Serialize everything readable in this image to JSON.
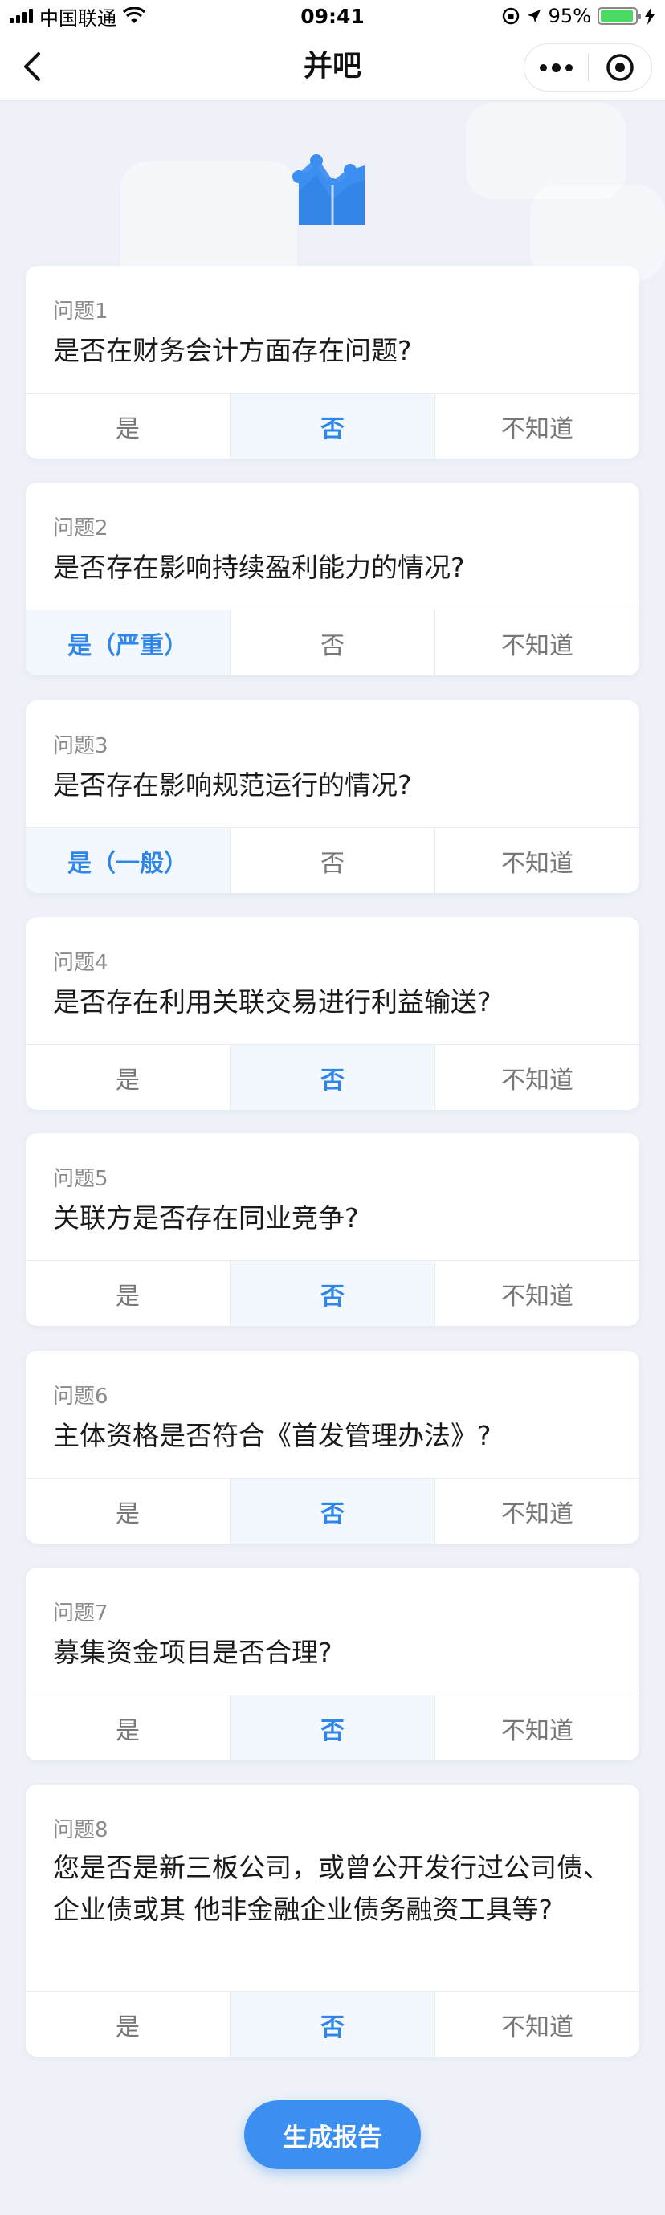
{
  "status_bar": {
    "carrier": "中国联通",
    "time": "09:41",
    "battery": "95%",
    "battery_level": 0.95
  },
  "nav": {
    "title": "并吧"
  },
  "questions": [
    {
      "label": "问题1",
      "text": "是否在财务会计方面存在问题?",
      "options": [
        "是",
        "否",
        "不知道"
      ],
      "selected": 1
    },
    {
      "label": "问题2",
      "text": "是否存在影响持续盈利能力的情况?",
      "options": [
        "是（严重）",
        "否",
        "不知道"
      ],
      "selected": 0
    },
    {
      "label": "问题3",
      "text": "是否存在影响规范运行的情况?",
      "options": [
        "是（一般）",
        "否",
        "不知道"
      ],
      "selected": 0
    },
    {
      "label": "问题4",
      "text": "是否存在利用关联交易进行利益输送?",
      "options": [
        "是",
        "否",
        "不知道"
      ],
      "selected": 1
    },
    {
      "label": "问题5",
      "text": "关联方是否存在同业竞争?",
      "options": [
        "是",
        "否",
        "不知道"
      ],
      "selected": 1
    },
    {
      "label": "问题6",
      "text": "主体资格是否符合《首发管理办法》?",
      "options": [
        "是",
        "否",
        "不知道"
      ],
      "selected": 1
    },
    {
      "label": "问题7",
      "text": "募集资金项目是否合理?",
      "options": [
        "是",
        "否",
        "不知道"
      ],
      "selected": 1
    },
    {
      "label": "问题8",
      "text": "您是否是新三板公司，或曾公开发行过公司债、企业债或其 他非金融企业债务融资工具等?",
      "options": [
        "是",
        "否",
        "不知道"
      ],
      "selected": 1
    }
  ],
  "generate_button": {
    "label": "生成报告"
  },
  "colors": {
    "accent": "#3a8ff0",
    "selected_text": "#2f86e8",
    "selected_bg": "#f3f8fe",
    "page_bg": "#eef1f7"
  },
  "icons": {
    "back": "chevron-left-icon",
    "more": "more-dots-icon",
    "close": "target-close-icon",
    "header": "chart-trend-icon"
  }
}
